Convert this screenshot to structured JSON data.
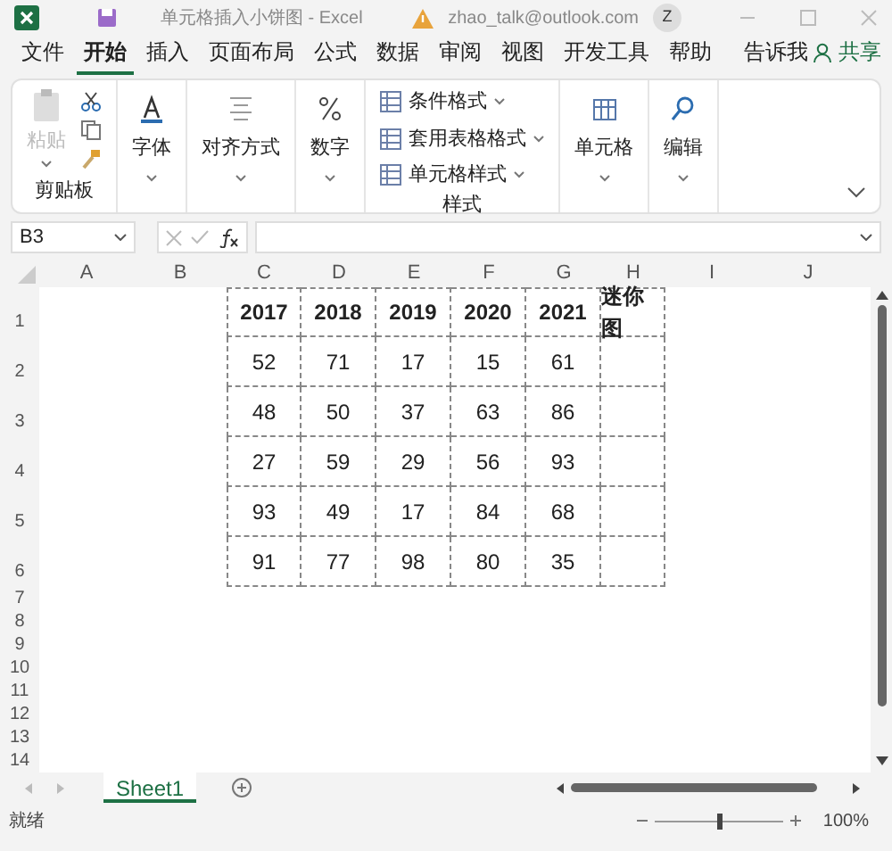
{
  "title_bar": {
    "title": "单元格插入小饼图 - Excel",
    "account": "zhao_talk@outlook.com",
    "avatar": "Z"
  },
  "tabs": [
    {
      "label": "文件",
      "selected": false
    },
    {
      "label": "开始",
      "selected": true
    },
    {
      "label": "插入",
      "selected": false
    },
    {
      "label": "页面布局",
      "selected": false
    },
    {
      "label": "公式",
      "selected": false
    },
    {
      "label": "数据",
      "selected": false
    },
    {
      "label": "审阅",
      "selected": false
    },
    {
      "label": "视图",
      "selected": false
    },
    {
      "label": "开发工具",
      "selected": false
    },
    {
      "label": "帮助",
      "selected": false
    }
  ],
  "tell_me": "告诉我",
  "share": "共享",
  "ribbon": {
    "groups": [
      {
        "kind": "clipboard",
        "paste": {
          "label": "粘贴",
          "disabled": true
        },
        "label": "剪贴板"
      },
      {
        "kind": "font",
        "label": "字体"
      },
      {
        "kind": "alignment",
        "label": "对齐方式"
      },
      {
        "kind": "number",
        "label": "数字"
      },
      {
        "kind": "styles",
        "items": [
          "条件格式",
          "套用表格格式",
          "单元格样式"
        ],
        "label": "样式"
      },
      {
        "kind": "cells",
        "label": "单元格"
      },
      {
        "kind": "editing",
        "label": "编辑"
      }
    ]
  },
  "formula_bar": {
    "name_box": "B3"
  },
  "columns": [
    "A",
    "B",
    "C",
    "D",
    "E",
    "F",
    "G",
    "H",
    "I",
    "J"
  ],
  "rows": [
    "1",
    "2",
    "3",
    "4",
    "5",
    "6",
    "7",
    "8",
    "9",
    "10",
    "11",
    "12",
    "13",
    "14"
  ],
  "table": [
    [
      "2017",
      "2018",
      "2019",
      "2020",
      "2021",
      "迷你图"
    ],
    [
      "52",
      "71",
      "17",
      "15",
      "61"
    ],
    [
      "48",
      "50",
      "37",
      "63",
      "86"
    ],
    [
      "27",
      "59",
      "29",
      "56",
      "93"
    ],
    [
      "93",
      "49",
      "17",
      "84",
      "68"
    ],
    [
      "91",
      "77",
      "98",
      "80",
      "35"
    ]
  ],
  "sheet_tabs": [
    {
      "label": "Sheet1",
      "selected": true
    }
  ],
  "status": "就绪",
  "zoom": {
    "level": 0.5,
    "reading": "100%"
  }
}
